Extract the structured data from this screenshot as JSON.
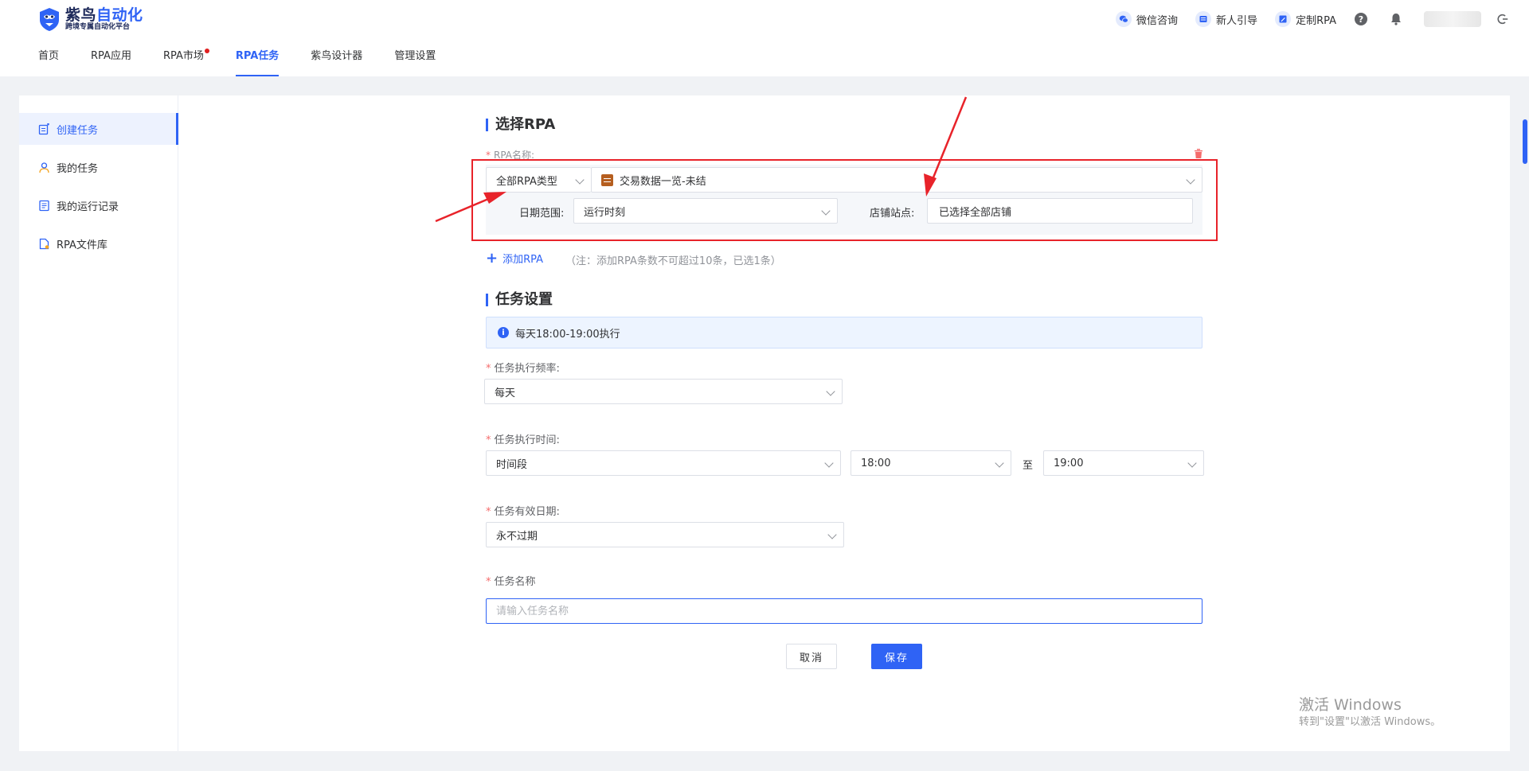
{
  "brand": {
    "name_part1": "紫鸟",
    "name_part2": "自动化",
    "tagline": "跨境专属自动化平台"
  },
  "nav": {
    "items": [
      {
        "label": "首页",
        "active": false
      },
      {
        "label": "RPA应用",
        "active": false
      },
      {
        "label": "RPA市场",
        "active": false,
        "dot": true
      },
      {
        "label": "RPA任务",
        "active": true
      },
      {
        "label": "紫鸟设计器",
        "active": false
      },
      {
        "label": "管理设置",
        "active": false
      }
    ]
  },
  "top_right": {
    "wechat": "微信咨询",
    "guide": "新人引导",
    "custom": "定制RPA"
  },
  "sidebar": {
    "items": [
      {
        "label": "创建任务",
        "icon": "create-task-icon",
        "active": true
      },
      {
        "label": "我的任务",
        "icon": "user-icon",
        "active": false
      },
      {
        "label": "我的运行记录",
        "icon": "record-icon",
        "active": false
      },
      {
        "label": "RPA文件库",
        "icon": "file-icon",
        "active": false
      }
    ]
  },
  "form": {
    "section1_title": "选择RPA",
    "rpa_name_label": "RPA名称:",
    "rpa_type": "全部RPA类型",
    "rpa_selected": "交易数据一览-未结",
    "date_range_label": "日期范围:",
    "date_range_value": "运行时刻",
    "store_label": "店铺站点:",
    "store_value": "已选择全部店铺",
    "add_rpa": "添加RPA",
    "add_note": "（注：添加RPA条数不可超过10条，已选1条）",
    "section2_title": "任务设置",
    "notice": "每天18:00-19:00执行",
    "freq_label": "任务执行频率:",
    "freq_value": "每天",
    "time_label": "任务执行时间:",
    "time_mode": "时间段",
    "time_start": "18:00",
    "time_to": "至",
    "time_end": "19:00",
    "valid_label": "任务有效日期:",
    "valid_value": "永不过期",
    "name_label": "任务名称",
    "name_placeholder": "请输入任务名称",
    "cancel": "取消",
    "save": "保存"
  },
  "watermark": {
    "line1": "激活 Windows",
    "line2": "转到\"设置\"以激活 Windows。"
  },
  "colors": {
    "primary": "#2f63f5",
    "annotation": "#e8232a"
  }
}
